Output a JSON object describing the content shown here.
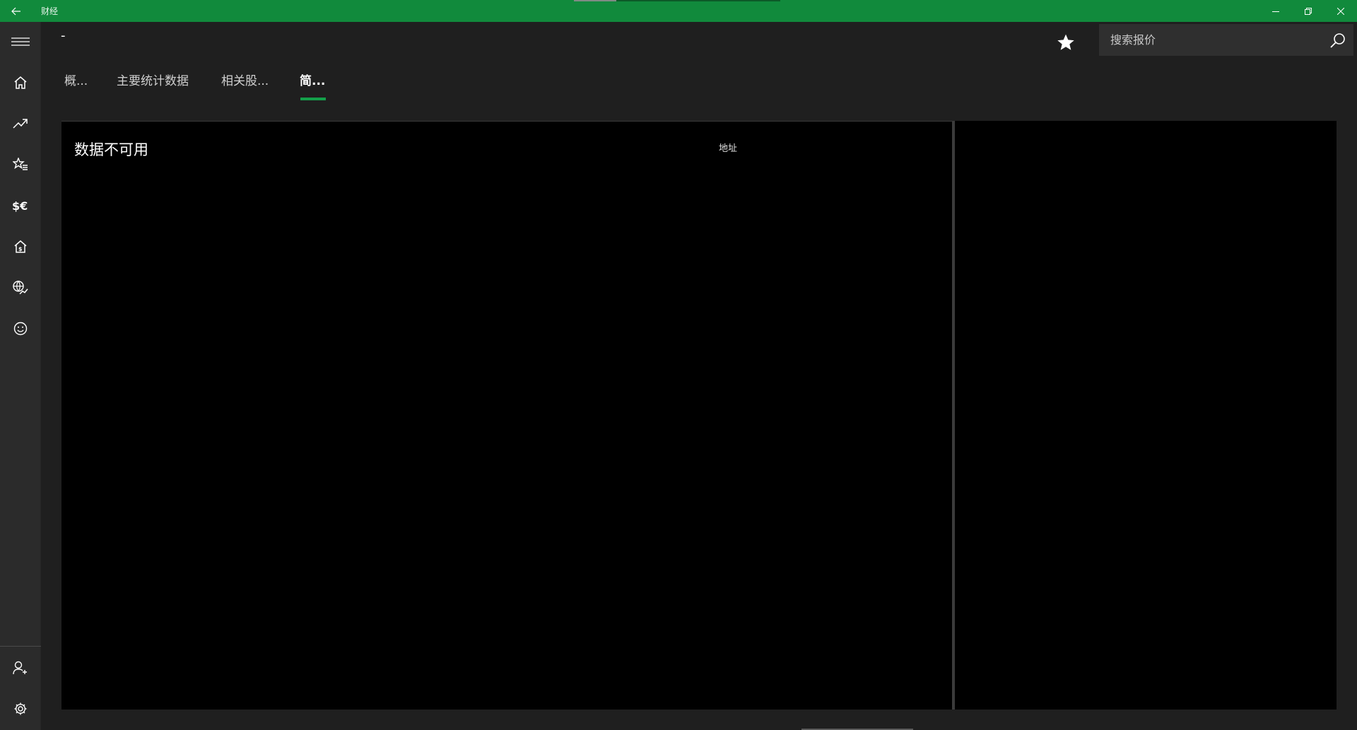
{
  "app": {
    "title": "财经",
    "accent_color": "#118a3c",
    "tab_accent_color": "#14a04a"
  },
  "titlebar": {
    "back_icon": "back-arrow-icon",
    "minimize_icon": "minimize-icon",
    "restore_icon": "restore-icon",
    "close_icon": "close-icon"
  },
  "nav": {
    "menu_icon": "hamburger-icon",
    "items": [
      {
        "icon": "home-icon"
      },
      {
        "icon": "trending-up-icon"
      },
      {
        "icon": "watchlist-star-icon"
      },
      {
        "icon": "currency-icon"
      },
      {
        "icon": "mortgage-home-icon"
      },
      {
        "icon": "world-markets-icon"
      },
      {
        "icon": "smiley-icon"
      }
    ],
    "bottom_items": [
      {
        "icon": "add-person-icon"
      },
      {
        "icon": "settings-gear-icon"
      }
    ]
  },
  "header": {
    "stock_name": "-",
    "favorite_icon": "star-icon",
    "search": {
      "placeholder": "搜索报价",
      "value": "",
      "icon": "search-icon"
    }
  },
  "tabs": [
    {
      "label": "概..."
    },
    {
      "label": "主要统计数据"
    },
    {
      "label": "相关股..."
    },
    {
      "label": "简...",
      "active": true
    }
  ],
  "main": {
    "no_data_text": "数据不可用",
    "address_label": "地址"
  }
}
